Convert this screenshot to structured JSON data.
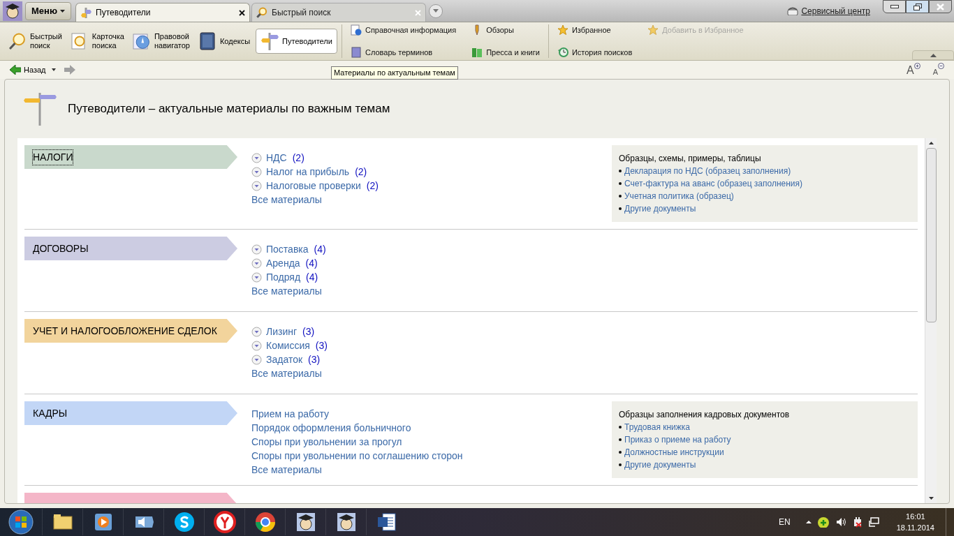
{
  "app": {
    "menu_label": "Меню",
    "tabs": [
      {
        "label": "Путеводители",
        "selected": true,
        "kind": "guide"
      },
      {
        "label": "Быстрый поиск",
        "selected": false,
        "kind": "search"
      }
    ],
    "service_link": "Сервисный центр"
  },
  "toolbar": {
    "main_buttons": [
      {
        "label": "Быстрый\nпоиск",
        "selected": false,
        "kind": "search"
      },
      {
        "label": "Карточка\nпоиска",
        "selected": false,
        "kind": "card"
      },
      {
        "label": "Правовой\nнавигатор",
        "selected": false,
        "kind": "compass"
      },
      {
        "label": "Кодексы",
        "selected": false,
        "kind": "book"
      },
      {
        "label": "Путеводители",
        "selected": true,
        "kind": "guide"
      }
    ],
    "links": [
      {
        "label": "Справочная информация",
        "disabled": false,
        "kind": "info"
      },
      {
        "label": "Словарь терминов",
        "disabled": false,
        "kind": "dict"
      },
      {
        "label": "Обзоры",
        "disabled": false,
        "kind": "pen"
      },
      {
        "label": "Пресса и книги",
        "disabled": false,
        "kind": "press"
      },
      {
        "label": "Избранное",
        "disabled": false,
        "kind": "star"
      },
      {
        "label": "История поисков",
        "disabled": false,
        "kind": "history"
      },
      {
        "label": "Добавить в Избранное",
        "disabled": true,
        "kind": "star"
      }
    ]
  },
  "nav": {
    "back": "Назад",
    "font_buttons": [
      "A",
      "A"
    ],
    "tooltip": "Материалы по актуальным темам"
  },
  "page_title": "Путеводители – актуальные материалы по важным темам",
  "sections": [
    {
      "title": "НАЛОГИ",
      "color": "#c9d9cc",
      "focused": true,
      "links": [
        {
          "text": "НДС",
          "count": "(2)",
          "expandable": true
        },
        {
          "text": "Налог на прибыль",
          "count": "(2)",
          "expandable": true
        },
        {
          "text": "Налоговые проверки",
          "count": "(2)",
          "expandable": true
        }
      ],
      "all_link": "Все материалы",
      "side": {
        "title": "Образцы, схемы, примеры, таблицы",
        "items": [
          "Декларация по НДС (образец заполнения)",
          "Счет-фактура на аванс (образец заполнения)",
          "Учетная политика (образец)",
          "Другие документы"
        ]
      }
    },
    {
      "title": "ДОГОВОРЫ",
      "color": "#cccce2",
      "focused": false,
      "links": [
        {
          "text": "Поставка",
          "count": "(4)",
          "expandable": true
        },
        {
          "text": "Аренда",
          "count": "(4)",
          "expandable": true
        },
        {
          "text": "Подряд",
          "count": "(4)",
          "expandable": true
        }
      ],
      "all_link": "Все материалы"
    },
    {
      "title": "УЧЕТ И НАЛОГООБЛОЖЕНИЕ СДЕЛОК",
      "color": "#f2d49c",
      "focused": false,
      "links": [
        {
          "text": "Лизинг",
          "count": "(3)",
          "expandable": true
        },
        {
          "text": "Комиссия",
          "count": "(3)",
          "expandable": true
        },
        {
          "text": "Задаток",
          "count": "(3)",
          "expandable": true
        }
      ],
      "all_link": "Все материалы"
    },
    {
      "title": "КАДРЫ",
      "color": "#c2d6f6",
      "focused": false,
      "links": [
        {
          "text": "Прием на работу",
          "expandable": false
        },
        {
          "text": "Порядок оформления больничного",
          "expandable": false
        },
        {
          "text": "Споры при увольнении за прогул",
          "expandable": false
        },
        {
          "text": "Споры при увольнении по соглашению сторон",
          "expandable": false
        }
      ],
      "all_link": "Все материалы",
      "side": {
        "title": "Образцы заполнения кадровых документов",
        "items": [
          "Трудовая книжка",
          "Приказ о приеме на работу",
          "Должностные инструкции",
          "Другие документы"
        ]
      }
    },
    {
      "color": "#f4b6c8"
    }
  ],
  "taskbar": {
    "language": "EN",
    "time": "16:01",
    "date": "18.11.2014"
  }
}
